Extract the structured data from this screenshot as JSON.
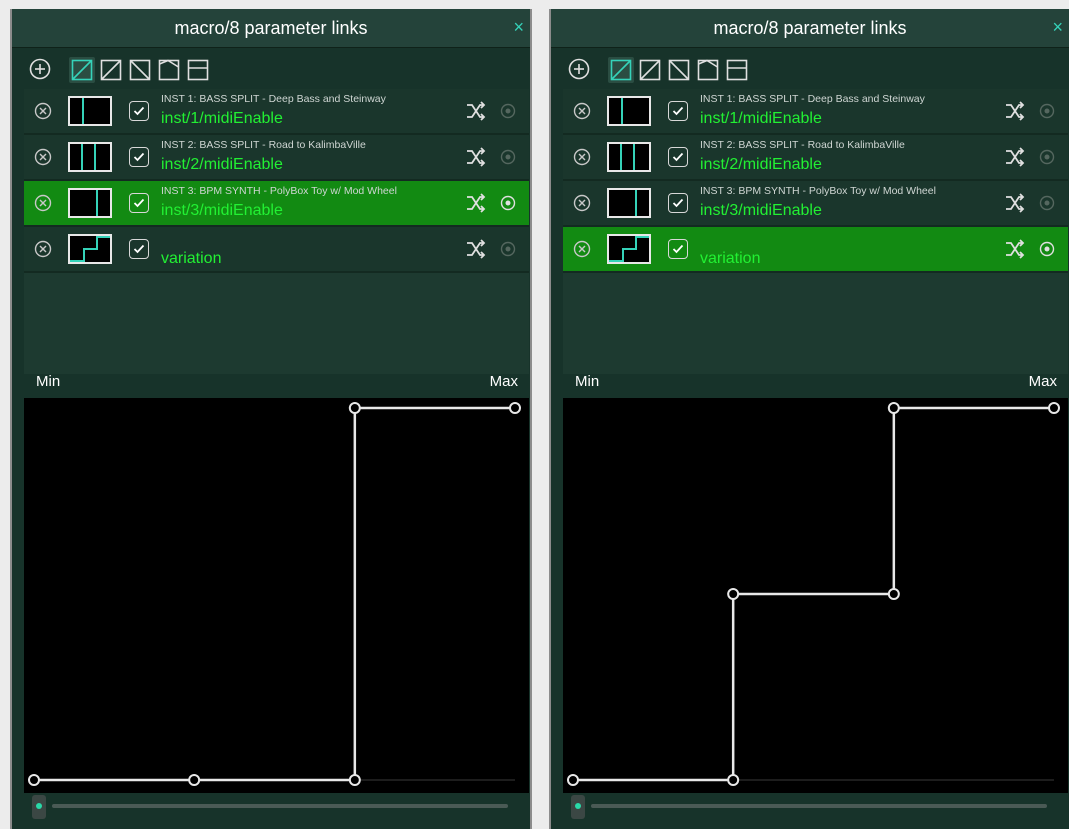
{
  "panels": [
    {
      "title": "macro/8 parameter links",
      "close_glyph": "×",
      "selected_row": 2,
      "rows": [
        {
          "name": "INST 1: BASS SPLIT - Deep Bass and Steinway",
          "path": "inst/1/midiEnable",
          "checked": true
        },
        {
          "name": "INST 2: BASS SPLIT - Road to KalimbaVille",
          "path": "inst/2/midiEnable",
          "checked": true
        },
        {
          "name": "INST 3: BPM SYNTH - PolyBox Toy w/ Mod Wheel",
          "path": "inst/3/midiEnable",
          "checked": true
        },
        {
          "name": "",
          "path": "variation",
          "checked": true
        }
      ],
      "axis": {
        "min_label": "Min",
        "max_label": "Max"
      },
      "curve_value_points": [
        [
          0,
          0
        ],
        [
          0.333,
          0
        ],
        [
          0.667,
          0
        ],
        [
          0.667,
          1
        ],
        [
          1,
          1
        ]
      ],
      "slider_value": 0
    },
    {
      "title": "macro/8 parameter links",
      "close_glyph": "×",
      "selected_row": 3,
      "rows": [
        {
          "name": "INST 1: BASS SPLIT - Deep Bass and Steinway",
          "path": "inst/1/midiEnable",
          "checked": true
        },
        {
          "name": "INST 2: BASS SPLIT - Road to KalimbaVille",
          "path": "inst/2/midiEnable",
          "checked": true
        },
        {
          "name": "INST 3: BPM SYNTH - PolyBox Toy w/ Mod Wheel",
          "path": "inst/3/midiEnable",
          "checked": true
        },
        {
          "name": "",
          "path": "variation",
          "checked": true
        }
      ],
      "axis": {
        "min_label": "Min",
        "max_label": "Max"
      },
      "curve_value_points": [
        [
          0,
          0
        ],
        [
          0.333,
          0
        ],
        [
          0.333,
          0.5
        ],
        [
          0.667,
          0.5
        ],
        [
          0.667,
          1
        ],
        [
          1,
          1
        ]
      ],
      "slider_value": 0
    }
  ],
  "toolbar_icons": [
    "add-icon",
    "curve-linear-up-icon",
    "curve-linear-icon",
    "curve-linear-down-icon",
    "curve-bend-icon",
    "curve-split-icon"
  ],
  "row_icons": [
    "remove-icon",
    "checkbox-icon",
    "shuffle-icon",
    "target-icon"
  ],
  "colors": {
    "panel_bg": "#17332a",
    "titlebar_bg": "#24433a",
    "accent_teal": "#35d3b9",
    "path_green": "#22f033",
    "selected_row_bg": "#128a12",
    "graph_bg": "#000000",
    "curve_color": "#e8e8e8"
  }
}
